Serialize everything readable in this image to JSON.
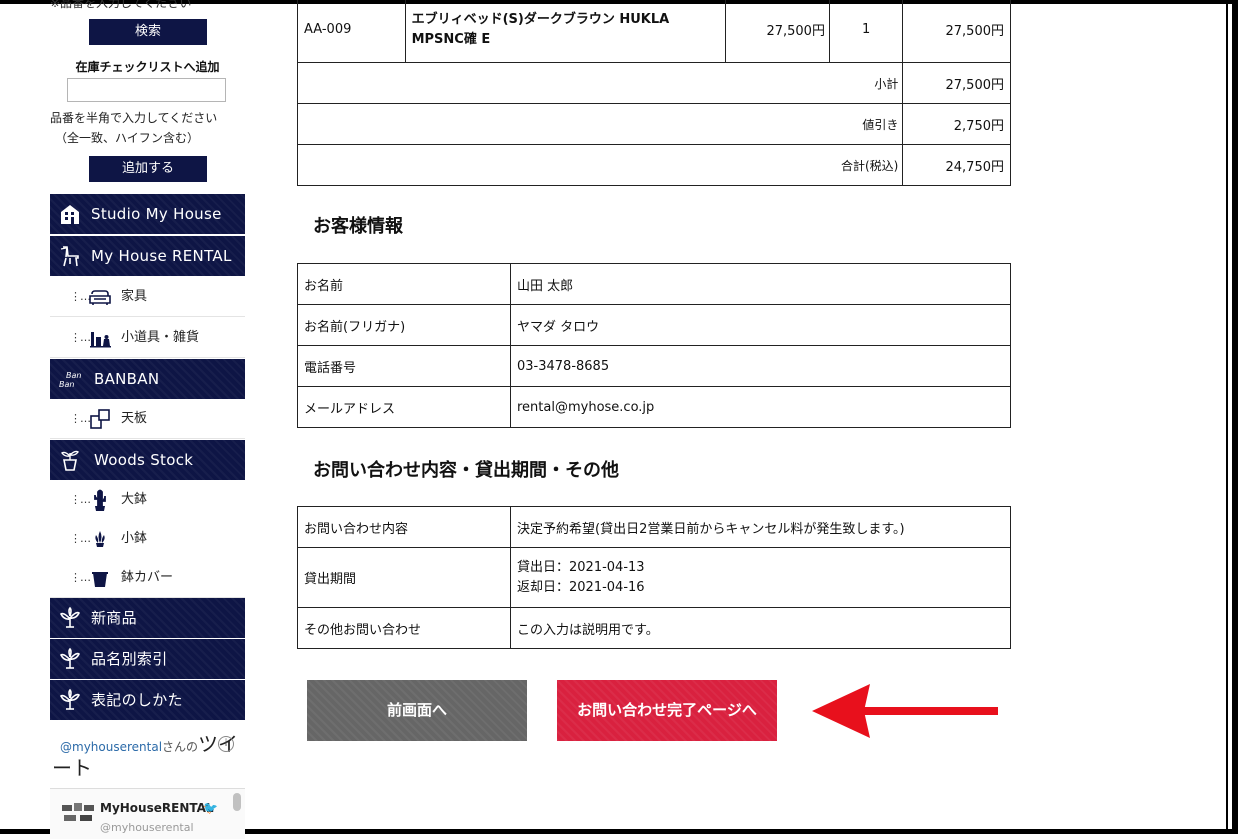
{
  "sidebar": {
    "cut_text": "※品番を入力してください",
    "search_button": "検索",
    "stock_title": "在庫チェックリストへ追加",
    "stock_note_line1": "品番を半角で入力してください",
    "stock_note_line2": "（全一致、ハイフン含む）",
    "add_button": "追加する",
    "categories": {
      "studio": "Studio My House",
      "rental": "My House RENTAL",
      "furniture": "家具",
      "goods": "小道具・雑貨",
      "banban": "BANBAN",
      "tenban": "天板",
      "woods": "Woods Stock",
      "large_pot": "大鉢",
      "small_pot": "小鉢",
      "pot_cover": "鉢カバー",
      "new_items": "新商品",
      "index": "品名別索引",
      "notation": "表記のしかた"
    },
    "twitter": {
      "handle_link": "@myhouserental",
      "suffix": "さんの",
      "tweet_word": "ツイ",
      "tweet_word2": "ート",
      "account_name": "MyHouseRENTAL",
      "account_handle": "@myhouserental"
    }
  },
  "order": {
    "item": {
      "code": "AA-009",
      "name": "エブリィベッド(S)ダークブラウン HUKLA MPSNC確 E",
      "price": "27,500円",
      "qty": "1",
      "amount": "27,500円"
    },
    "subtotal_label": "小計",
    "subtotal": "27,500円",
    "discount_label": "値引き",
    "discount": "2,750円",
    "total_label": "合計(税込)",
    "total": "24,750円"
  },
  "customer": {
    "title": "お客様情報",
    "rows": [
      {
        "label": "お名前",
        "value": "山田 太郎"
      },
      {
        "label": "お名前(フリガナ)",
        "value": "ヤマダ タロウ"
      },
      {
        "label": "電話番号",
        "value": "03-3478-8685"
      },
      {
        "label": "メールアドレス",
        "value": "rental@myhose.co.jp"
      }
    ]
  },
  "inquiry": {
    "title": "お問い合わせ内容・貸出期間・その他",
    "content_label": "お問い合わせ内容",
    "content_value": "決定予約希望(貸出日2営業日前からキャンセル料が発生致します。)",
    "period_label": "貸出期間",
    "period_line1": "貸出日：2021-04-13",
    "period_line2": "返却日：2021-04-16",
    "other_label": "その他お問い合わせ",
    "other_value": "この入力は説明用です。"
  },
  "buttons": {
    "back": "前画面へ",
    "complete": "お問い合わせ完了ページへ"
  },
  "colors": {
    "navy": "#0e1545",
    "red_button": "#d9213f",
    "gray_button": "#666666",
    "arrow": "#e8101c"
  }
}
